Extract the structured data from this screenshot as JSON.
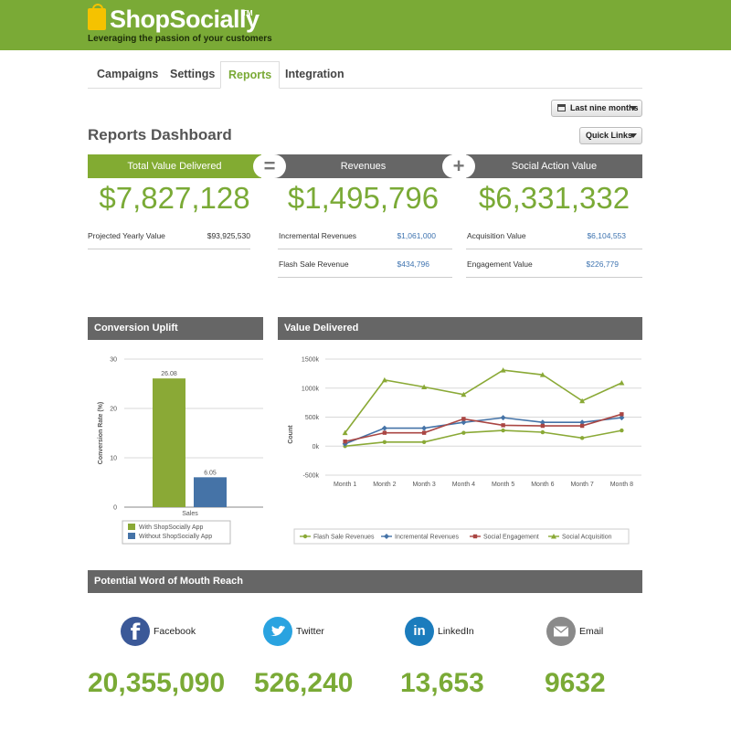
{
  "header": {
    "logo_text": "ShopSocially",
    "trademark": "TM",
    "tagline": "Leveraging the passion of your customers"
  },
  "tabs": [
    {
      "label": "Campaigns"
    },
    {
      "label": "Settings"
    },
    {
      "label": "Reports",
      "active": true
    },
    {
      "label": "Integration"
    }
  ],
  "controls": {
    "date_range": "Last nine months",
    "quick_links": "Quick Links"
  },
  "page_title": "Reports Dashboard",
  "summary": {
    "total": {
      "title": "Total Value Delivered",
      "value": "$7,827,128"
    },
    "op1": "=",
    "revenues": {
      "title": "Revenues",
      "value": "$1,495,796"
    },
    "op2": "+",
    "social": {
      "title": "Social Action Value",
      "value": "$6,331,332"
    },
    "projected_label": "Projected Yearly Value",
    "projected_value": "$93,925,530",
    "incremental_label": "Incremental Revenues",
    "incremental_value": "$1,061,000",
    "flash_label": "Flash Sale Revenue",
    "flash_value": "$434,796",
    "acquisition_label": "Acquisition Value",
    "acquisition_value": "$6,104,553",
    "engagement_label": "Engagement Value",
    "engagement_value": "$226,779"
  },
  "conversion_panel": {
    "title": "Conversion Uplift"
  },
  "value_panel": {
    "title": "Value Delivered"
  },
  "reach_panel": {
    "title": "Potential Word of Mouth Reach"
  },
  "chart_data": [
    {
      "type": "bar",
      "ylabel": "Conversion Rate (%)",
      "categories": [
        "Sales"
      ],
      "ylim": [
        0,
        30
      ],
      "yticks": [
        0,
        10,
        20,
        30
      ],
      "series": [
        {
          "name": "With ShopSocially App",
          "values": [
            26.08
          ],
          "label": "26.08",
          "color": "#8aa936"
        },
        {
          "name": "Without ShopSocially App",
          "values": [
            6.05
          ],
          "label": "6.05",
          "color": "#4573a7"
        }
      ],
      "legend": "bottom"
    },
    {
      "type": "line",
      "ylabel": "Count",
      "categories": [
        "Month 1",
        "Month 2",
        "Month 3",
        "Month 4",
        "Month 5",
        "Month 6",
        "Month 7",
        "Month 8"
      ],
      "ylim": [
        -500000,
        1500000
      ],
      "yticks": [
        -500000,
        0,
        500000,
        1000000,
        1500000
      ],
      "ytick_labels": [
        "-500k",
        "0k",
        "500k",
        "1000k",
        "1500k"
      ],
      "series": [
        {
          "name": "Flash Sale Revenues",
          "color": "#8aa936",
          "marker": "circle",
          "values": [
            0,
            70000,
            70000,
            230000,
            270000,
            240000,
            140000,
            270000
          ]
        },
        {
          "name": "Incremental Revenues",
          "color": "#4573a7",
          "marker": "diamond",
          "values": [
            40000,
            310000,
            310000,
            410000,
            490000,
            410000,
            410000,
            490000
          ]
        },
        {
          "name": "Social Engagement",
          "color": "#aa4643",
          "marker": "square",
          "values": [
            80000,
            230000,
            230000,
            470000,
            360000,
            350000,
            350000,
            550000
          ]
        },
        {
          "name": "Social Acquisition",
          "color": "#8aa936",
          "marker": "triangle",
          "values": [
            230000,
            1140000,
            1020000,
            890000,
            1310000,
            1230000,
            780000,
            1090000
          ]
        }
      ],
      "legend": "bottom"
    }
  ],
  "reach": [
    {
      "name": "Facebook",
      "icon": "facebook-icon",
      "color": "#3b5998",
      "value": "20,355,090"
    },
    {
      "name": "Twitter",
      "icon": "twitter-icon",
      "color": "#2aa3e0",
      "value": "526,240"
    },
    {
      "name": "LinkedIn",
      "icon": "linkedin-icon",
      "color": "#1b7cbd",
      "value": "13,653"
    },
    {
      "name": "Email",
      "icon": "email-icon",
      "color": "#8a8a8a",
      "value": "9632"
    }
  ]
}
